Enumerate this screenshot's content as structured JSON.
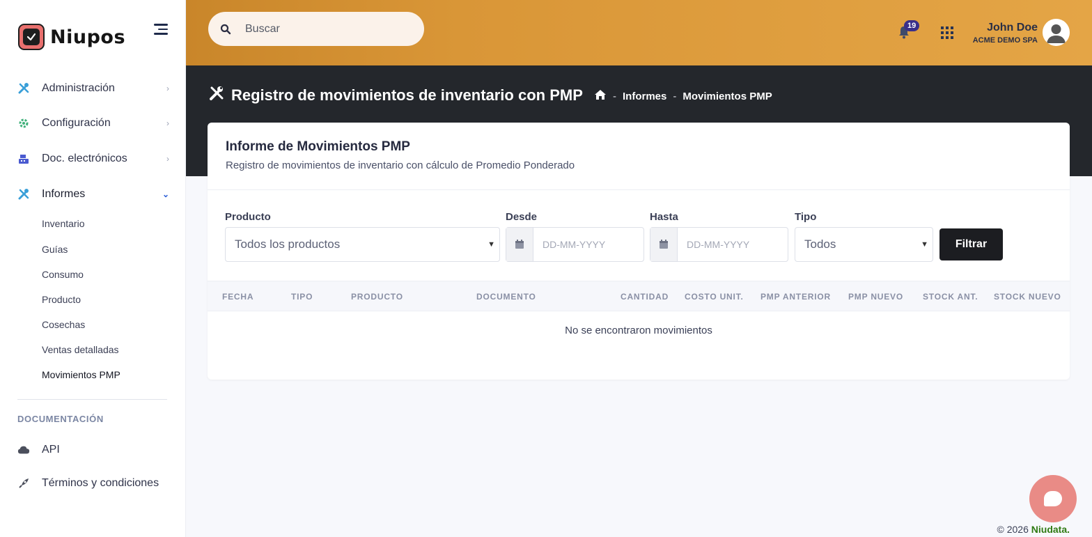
{
  "brand": {
    "name": "Niupos"
  },
  "sidebar": {
    "items": [
      {
        "label": "Administración",
        "icon": "tools-icon"
      },
      {
        "label": "Configuración",
        "icon": "gear-icon"
      },
      {
        "label": "Doc. electrónicos",
        "icon": "cash-register-icon"
      },
      {
        "label": "Informes",
        "icon": "tools-icon"
      }
    ],
    "sub_items": [
      "Inventario",
      "Guías",
      "Consumo",
      "Producto",
      "Cosechas",
      "Ventas detalladas",
      "Movimientos PMP"
    ],
    "section_label": "DOCUMENTACIÓN",
    "doc_items": [
      {
        "label": "API",
        "icon": "cloud-icon"
      },
      {
        "label": "Términos y condiciones",
        "icon": "rocket-icon"
      }
    ]
  },
  "topbar": {
    "search_placeholder": "Buscar",
    "notifications_count": "19",
    "user_name": "John Doe",
    "user_company": "ACME DEMO SPA"
  },
  "page": {
    "title": "Registro de movimientos de inventario con PMP",
    "breadcrumb": [
      "Informes",
      "Movimientos PMP"
    ]
  },
  "card": {
    "title": "Informe de Movimientos PMP",
    "subtitle": "Registro de movimientos de inventario con cálculo de Promedio Ponderado",
    "filters": {
      "producto_label": "Producto",
      "producto_value": "Todos los productos",
      "desde_label": "Desde",
      "desde_placeholder": "DD-MM-YYYY",
      "hasta_label": "Hasta",
      "hasta_placeholder": "DD-MM-YYYY",
      "tipo_label": "Tipo",
      "tipo_value": "Todos",
      "button": "Filtrar"
    },
    "table": {
      "columns": [
        "FECHA",
        "TIPO",
        "PRODUCTO",
        "DOCUMENTO",
        "CANTIDAD",
        "COSTO UNIT.",
        "PMP ANTERIOR",
        "PMP NUEVO",
        "STOCK ANT.",
        "STOCK NUEVO"
      ],
      "empty_message": "No se encontraron movimientos"
    }
  },
  "footer": {
    "copyright": "© 2026",
    "brand": "Niudata."
  },
  "colors": {
    "accent": "#d99637",
    "dark_header": "#24272c",
    "chat": "#e98b86",
    "footer_brand": "#2f7a13"
  }
}
